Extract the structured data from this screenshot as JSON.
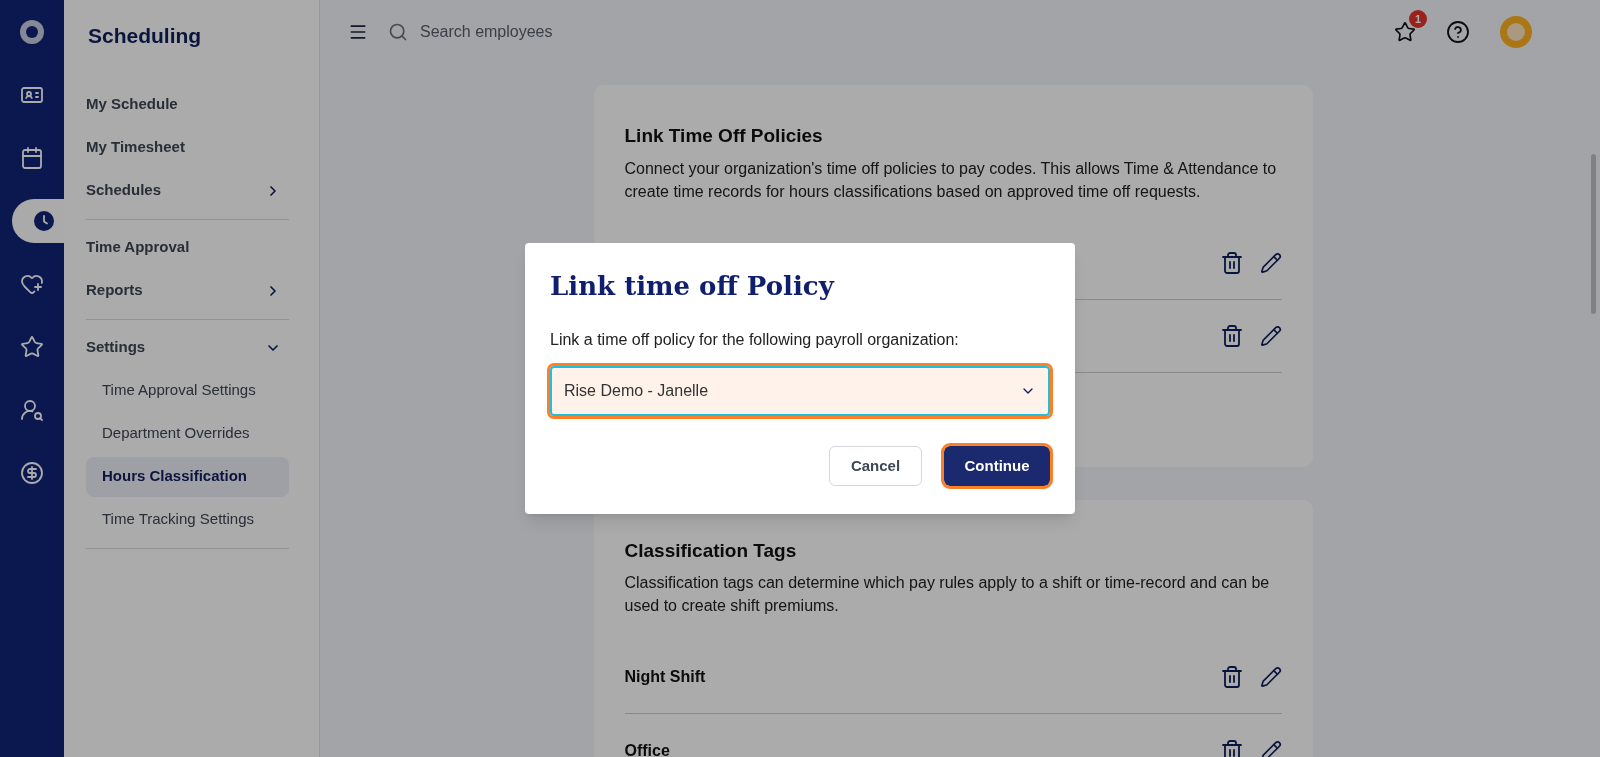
{
  "rail": {
    "items": [
      {
        "kind": "logo",
        "selected": false
      },
      {
        "kind": "id-card",
        "selected": false
      },
      {
        "kind": "calendar",
        "selected": false
      },
      {
        "kind": "clock",
        "selected": true
      },
      {
        "kind": "heart-plus",
        "selected": false
      },
      {
        "kind": "star",
        "selected": false
      },
      {
        "kind": "user-search",
        "selected": false
      },
      {
        "kind": "dollar",
        "selected": false
      }
    ]
  },
  "sidebar": {
    "title": "Scheduling",
    "sections": [
      {
        "items": [
          {
            "label": "My Schedule",
            "selected": false
          },
          {
            "label": "My Timesheet",
            "selected": false
          },
          {
            "label": "Schedules",
            "selected": false,
            "expanded": false
          }
        ]
      },
      {
        "items": [
          {
            "label": "Time Approval",
            "selected": false
          },
          {
            "label": "Reports",
            "selected": false,
            "expanded": false
          }
        ]
      },
      {
        "items": [
          {
            "label": "Settings",
            "selected": false,
            "expanded": true,
            "children": [
              {
                "label": "Time Approval Settings",
                "selected": false
              },
              {
                "label": "Department Overrides",
                "selected": false
              },
              {
                "label": "Hours Classification",
                "selected": true
              },
              {
                "label": "Time Tracking Settings",
                "selected": false
              }
            ]
          }
        ]
      }
    ]
  },
  "header": {
    "search": {
      "placeholder": "Search employees"
    },
    "notifications": {
      "badge": "1"
    }
  },
  "cards": [
    {
      "title": "Link Time Off Policies",
      "description": "Connect your organization's time off policies to pay codes. This allows Time & Attendance to create time records for hours classifications based on approved time off requests.",
      "rows": [
        {
          "kind": "covered"
        },
        {
          "kind": "covered"
        }
      ]
    },
    {
      "title": "Classification Tags",
      "description": "Classification tags can determine which pay rules apply to a shift or time-record and can be used to create shift premiums.",
      "rows": [
        {
          "kind": "tag",
          "label": "Night Shift"
        },
        {
          "kind": "tag",
          "label": "Office"
        }
      ]
    }
  ],
  "modal": {
    "title": "Link time off Policy",
    "message": "Link a time off policy for the following payroll organization:",
    "select": {
      "value": "Rise Demo - Janelle"
    },
    "buttons": [
      {
        "label": "Cancel",
        "kind": "secondary"
      },
      {
        "label": "Continue",
        "kind": "primary"
      }
    ]
  }
}
